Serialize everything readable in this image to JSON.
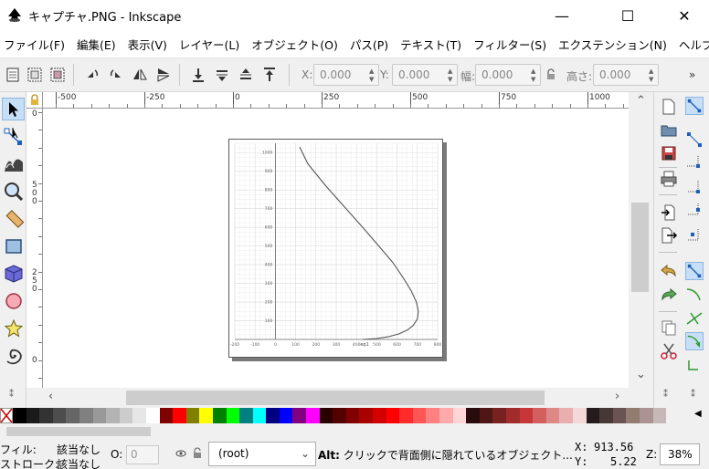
{
  "window": {
    "title": "キャプチャ.PNG - Inkscape",
    "minimize": "—",
    "maximize": "☐",
    "close": "✕"
  },
  "menu": [
    "ファイル(F)",
    "編集(E)",
    "表示(V)",
    "レイヤー(L)",
    "オブジェクト(O)",
    "パス(P)",
    "テキスト(T)",
    "フィルター(S)",
    "エクステンション(N)",
    "ヘルプ(H)"
  ],
  "toolbar": {
    "x_label": "X:",
    "x_value": "0.000",
    "y_label": "Y:",
    "y_value": "0.000",
    "w_label": "幅:",
    "w_value": "0.000",
    "h_label": "高さ:",
    "h_value": "0.000",
    "overflow": "»"
  },
  "ruler": {
    "top": [
      "-500",
      "-250",
      "0",
      "250",
      "500",
      "750",
      "1000"
    ],
    "left": [
      "0",
      "5\n0\n0",
      "2\n5\n0",
      "0"
    ]
  },
  "chart_data": {
    "type": "line",
    "title": "",
    "xlabel": "eq1",
    "ylabel": "",
    "xlim": [
      -200,
      800
    ],
    "ylim": [
      0,
      1050
    ],
    "xticks": [
      -200,
      -100,
      0,
      100,
      200,
      300,
      400,
      500,
      600,
      700,
      800
    ],
    "xtick_labels": [
      "-200",
      "-100",
      "0",
      "100",
      "200",
      "300",
      "400",
      "500",
      "600",
      "700",
      "800"
    ],
    "yticks": [
      100,
      200,
      300,
      400,
      500,
      600,
      700,
      800,
      900,
      1000
    ],
    "ytick_labels": [
      "100",
      "200",
      "300",
      "400",
      "500",
      "600",
      "700",
      "800",
      "900",
      "1000"
    ],
    "grid": true,
    "series": [
      {
        "x": [
          430,
          500,
          560,
          610,
          650,
          680,
          700,
          705,
          695,
          670,
          630,
          580,
          510,
          430,
          340,
          250,
          160,
          120
        ],
        "y": [
          0,
          5,
          15,
          30,
          50,
          75,
          110,
          150,
          200,
          260,
          330,
          410,
          500,
          600,
          710,
          820,
          940,
          1030
        ]
      }
    ],
    "color": "#555555"
  },
  "statusbar": {
    "fill_label": "フィル:",
    "fill_value": "該当なし",
    "stroke_label": "ストローク:",
    "stroke_value": "該当なし",
    "opacity_label": "O:",
    "opacity_value": "0",
    "layer": "(root)",
    "message_bold": "Alt:",
    "message": " クリックで背面側に隠れているオブジェクト...",
    "cx_label": "X:",
    "cx_value": "913.56",
    "cy_label": "Y:",
    "cy_value": "5.22",
    "zoom_label": "Z:",
    "zoom_value": "38%"
  },
  "palette": [
    "#000000",
    "#1a1a1a",
    "#333333",
    "#4d4d4d",
    "#666666",
    "#808080",
    "#999999",
    "#b3b3b3",
    "#cccccc",
    "#e6e6e6",
    "#ffffff",
    "#800000",
    "#ff0000",
    "#808000",
    "#ffff00",
    "#008000",
    "#00ff00",
    "#008080",
    "#00ffff",
    "#000080",
    "#0000ff",
    "#800080",
    "#ff00ff",
    "#2b0000",
    "#550000",
    "#800000",
    "#aa0000",
    "#d40000",
    "#ff0000",
    "#ff2a2a",
    "#ff5555",
    "#ff8080",
    "#ffaaaa",
    "#ffd5d5",
    "#280b0b",
    "#501616",
    "#782121",
    "#a02c2c",
    "#c83737",
    "#d35f5f",
    "#de8787",
    "#e9afaf",
    "#f4d7d7",
    "#241c1c",
    "#483737",
    "#6c5353",
    "#917c6f",
    "#ac9393",
    "#c8b7b7"
  ]
}
